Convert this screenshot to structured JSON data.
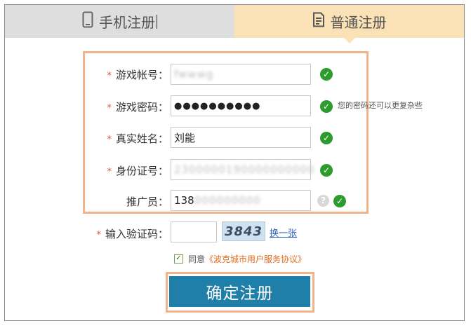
{
  "tabs": {
    "mobile_label": "手机注册",
    "normal_label": "普通注册"
  },
  "form": {
    "account": {
      "label": "游戏帐号：",
      "value": "fwwwg"
    },
    "password": {
      "label": "游戏密码：",
      "value": "●●●●●●●●●●",
      "hint": "您的密码还可以更复杂些"
    },
    "realname": {
      "label": "真实姓名：",
      "value": "刘能"
    },
    "idcard": {
      "label": "身份证号：",
      "value": "2300000190000000000"
    },
    "promoter": {
      "label": "推广员：",
      "value_visible": "138",
      "value_blurred": "000000000"
    },
    "captcha": {
      "label": "输入验证码：",
      "image_text": "3843",
      "refresh_label": "换一张"
    },
    "required_mark": "*",
    "check_mark": "✓",
    "help_mark": "?"
  },
  "agreement": {
    "prefix": "同意",
    "link": "《波克城市用户服务协议》",
    "checked": true
  },
  "submit_label": "确定注册"
}
